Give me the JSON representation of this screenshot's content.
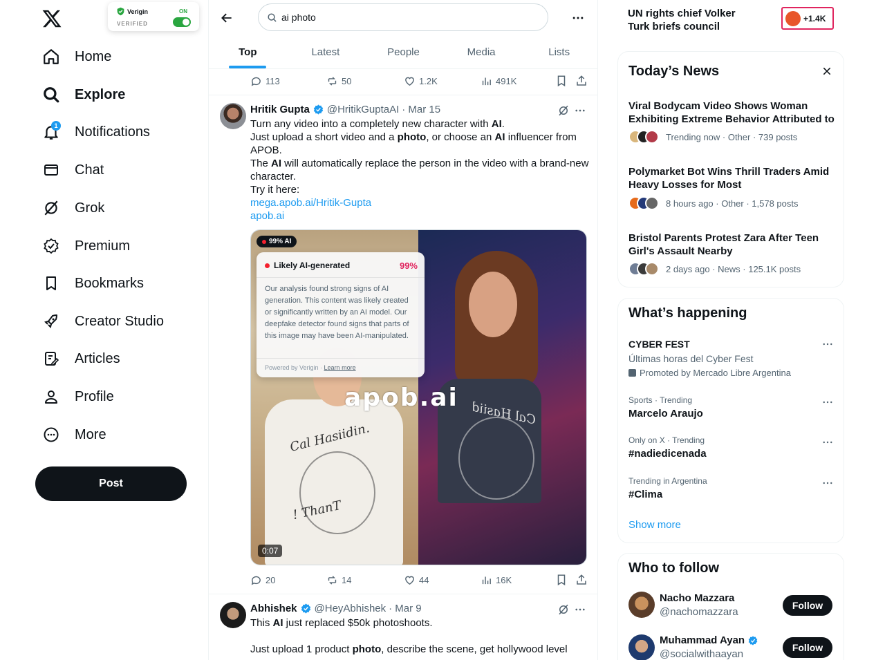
{
  "extension": {
    "brand": "Verigin",
    "status": "VERIFIED",
    "toggle_label": "ON"
  },
  "nav": {
    "items": [
      {
        "label": "Home",
        "icon": "home-icon"
      },
      {
        "label": "Explore",
        "icon": "search-icon"
      },
      {
        "label": "Notifications",
        "icon": "bell-icon",
        "badge": "1"
      },
      {
        "label": "Chat",
        "icon": "mail-icon"
      },
      {
        "label": "Grok",
        "icon": "grok-icon"
      },
      {
        "label": "Premium",
        "icon": "verified-icon"
      },
      {
        "label": "Bookmarks",
        "icon": "bookmark-icon"
      },
      {
        "label": "Creator Studio",
        "icon": "rocket-icon"
      },
      {
        "label": "Articles",
        "icon": "article-icon"
      },
      {
        "label": "Profile",
        "icon": "person-icon"
      },
      {
        "label": "More",
        "icon": "more-circle-icon"
      }
    ],
    "post_label": "Post"
  },
  "search": {
    "value": "ai photo"
  },
  "tabs": [
    "Top",
    "Latest",
    "People",
    "Media",
    "Lists"
  ],
  "prev_actions": {
    "replies": "113",
    "reposts": "50",
    "likes": "1.2K",
    "views": "491K"
  },
  "tweet1": {
    "name": "Hritik Gupta",
    "handle": "@HritikGuptaAI",
    "date": "· Mar 15",
    "line1_a": "Turn any video into a completely new character with ",
    "line1_b": "AI",
    "line1_c": ".",
    "line2_a": "Just upload a short video and a ",
    "line2_b": "photo",
    "line2_c": ", or choose an ",
    "line2_d": "AI",
    "line2_e": " influencer from APOB.",
    "line3_a": "The ",
    "line3_b": "AI",
    "line3_c": " will automatically replace the person in the video with a brand-new character.",
    "line4": "Try it here:",
    "link1": "mega.apob.ai/Hritik-Gupta",
    "link2": "apob.ai",
    "media": {
      "ai_chip": "99% AI",
      "card_title": "Likely AI-generated",
      "card_pct": "99%",
      "card_body": "Our analysis found strong signs of AI generation. This content was likely created or significantly written by an AI model. Our deepfake detector found signs that parts of this image may have been AI-manipulated.",
      "card_powered": "Powered by Verigin · ",
      "card_learn": "Learn more",
      "watermark": "apob.ai",
      "shirt_left": "Cal Hasiidin.",
      "shirt_left_2": "! ThanT",
      "shirt_right": "Cal Hasiid",
      "duration": "0:07"
    },
    "actions": {
      "replies": "20",
      "reposts": "14",
      "likes": "44",
      "views": "16K"
    }
  },
  "tweet2": {
    "name": "Abhishek",
    "handle": "@HeyAbhishek",
    "date": "· Mar 9",
    "line1_a": "This ",
    "line1_b": "AI",
    "line1_c": " just replaced $50k photoshoots.",
    "line2_a": "Just upload 1 product ",
    "line2_b": "photo",
    "line2_c": ", describe the scene, get hollywood level"
  },
  "top_news": {
    "headline": "UN rights chief Volker Turk briefs council",
    "count": "+1.4K"
  },
  "todays_news": {
    "title": "Today’s News",
    "items": [
      {
        "headline": "Viral Bodycam Video Shows Woman Exhibiting Extreme Behavior Attributed to ...",
        "meta": "Trending now · Other · 739 posts"
      },
      {
        "headline": "Polymarket Bot Wins Thrill Traders Amid Heavy Losses for Most",
        "meta": "8 hours ago · Other · 1,578 posts"
      },
      {
        "headline": "Bristol Parents Protest Zara After Teen Girl's Assault Nearby",
        "meta": "2 days ago · News · 125.1K posts"
      }
    ]
  },
  "happening": {
    "title": "What’s happening",
    "promo": {
      "title": "CYBER FEST",
      "subtitle": "Últimas horas del Cyber Fest",
      "promoted": "Promoted by Mercado Libre Argentina"
    },
    "trends": [
      {
        "context": "Sports · Trending",
        "name": "Marcelo Araujo"
      },
      {
        "context": "Only on X · Trending",
        "name": "#nadiedicenada"
      },
      {
        "context": "Trending in Argentina",
        "name": "#Clima"
      }
    ],
    "show_more": "Show more"
  },
  "who_to_follow": {
    "title": "Who to follow",
    "users": [
      {
        "name": "Nacho Mazzara",
        "handle": "@nachomazzara",
        "button": "Follow"
      },
      {
        "name": "Muhammad Ayan",
        "handle": "@socialwithaayan",
        "button": "Follow"
      }
    ]
  },
  "colors": {
    "accent": "#1d9bf0",
    "text": "#0f1419",
    "muted": "#536471",
    "ai_red": "#f4212e",
    "verigin_green": "#2aa640"
  }
}
